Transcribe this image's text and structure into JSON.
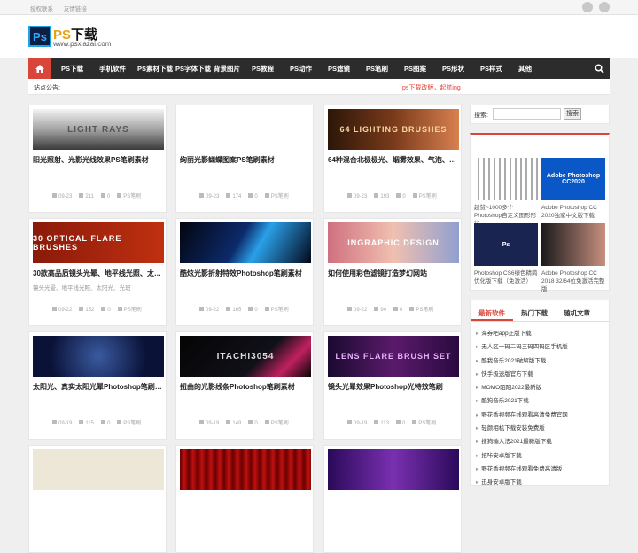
{
  "topbar": {
    "links": [
      "授权联系",
      "友情链接"
    ]
  },
  "header": {
    "logo_mark": "Ps",
    "title_prefix": "PS",
    "title_main": "下载",
    "url": "www.psxiazai.com"
  },
  "nav": {
    "items": [
      "PS下载",
      "手机软件",
      "PS素材下载",
      "PS字体下载",
      "背景图片",
      "PS教程",
      "PS动作",
      "PS滤镜",
      "PS笔刷",
      "PS图案",
      "PS形状",
      "PS样式",
      "其他"
    ]
  },
  "notice": {
    "label": "站点公告:",
    "text": "ps下载改版，起航ing"
  },
  "cards": [
    {
      "title": "阳光照射、光影光线效果PS笔刷素材",
      "date": "09-23",
      "views": "211",
      "comments": "0",
      "cat": "PS笔刷",
      "thumb_text": "LIGHT RAYS",
      "thumb_bg": "linear-gradient(180deg,#f4f4f4 0%,#9a9a9a 55%,#3a3a3a 100%)",
      "thumb_color": "#555"
    },
    {
      "title": "绚丽光影蝴蝶图案PS笔刷素材",
      "date": "09-23",
      "views": "174",
      "comments": "0",
      "cat": "PS笔刷",
      "thumb_text": "",
      "thumb_bg": "#ffffff",
      "thumb_color": "#2a3a7a"
    },
    {
      "title": "64种混合北极极光、烟雾效果、气泡、…",
      "date": "09-23",
      "views": "193",
      "comments": "0",
      "cat": "PS笔刷",
      "thumb_text": "64 LIGHTING BRUSHES",
      "thumb_bg": "linear-gradient(90deg,#2c1608,#7a3a1a,#d88050)",
      "thumb_color": "#f3d9a0"
    },
    {
      "title": "30款高品质镜头光晕、地平线光照、太…",
      "desc": "镜头光晕、地平线光照、太阳光、光斑",
      "date": "09-22",
      "views": "152",
      "comments": "0",
      "cat": "PS笔刷",
      "thumb_text": "30 OPTICAL FLARE BRUSHES",
      "thumb_bg": "linear-gradient(90deg,#8a1a0a,#c03010)",
      "thumb_color": "#ffffff"
    },
    {
      "title": "酷炫光影折射特效Photoshop笔刷素材",
      "date": "09-22",
      "views": "165",
      "comments": "0",
      "cat": "PS笔刷",
      "thumb_text": "",
      "thumb_bg": "linear-gradient(120deg,#03050f 0%,#0c2a6a 45%,#2aa0e8 60%,#04071a 100%)",
      "thumb_color": "#fff"
    },
    {
      "title": "如何使用彩色滤镜打造梦幻网站",
      "date": "09-22",
      "views": "94",
      "comments": "0",
      "cat": "PS笔刷",
      "thumb_text": "INGRAPHIC DESIGN",
      "thumb_bg": "linear-gradient(90deg,#d07080,#f0c0b0,#90a0d0)",
      "thumb_color": "#ffffff"
    },
    {
      "title": "太阳光、真实太阳光晕Photoshop笔刷…",
      "date": "09-19",
      "views": "115",
      "comments": "0",
      "cat": "PS笔刷",
      "thumb_text": "",
      "thumb_bg": "radial-gradient(circle at 50% 50%,#3a5aa0 0%,#0a1238 70%)",
      "thumb_color": "#fff"
    },
    {
      "title": "扭曲的光影线条Photoshop笔刷素材",
      "date": "09-19",
      "views": "149",
      "comments": "0",
      "cat": "PS笔刷",
      "thumb_text": "ITACHI3054",
      "thumb_bg": "linear-gradient(135deg,#050505,#101018 60%,#c02060 80%,#050505)",
      "thumb_color": "#dddddd"
    },
    {
      "title": "镜头光晕效果Photoshop光特效笔刷",
      "date": "09-19",
      "views": "113",
      "comments": "0",
      "cat": "PS笔刷",
      "thumb_text": "LENS FLARE BRUSH SET",
      "thumb_bg": "linear-gradient(90deg,#1a0a30,#5a1a6a,#2a0a40)",
      "thumb_color": "#e8b0ff"
    },
    {
      "title": "",
      "date": "",
      "views": "",
      "comments": "",
      "cat": "",
      "thumb_text": "",
      "thumb_bg": "#ede7d8",
      "thumb_color": "#333"
    },
    {
      "title": "",
      "date": "",
      "views": "",
      "comments": "",
      "cat": "",
      "thumb_text": "",
      "thumb_bg": "repeating-linear-gradient(90deg,#6a0000 0px,#c01010 5px,#6a0000 10px)",
      "thumb_color": "#fff"
    },
    {
      "title": "",
      "date": "",
      "views": "",
      "comments": "",
      "cat": "",
      "thumb_text": "",
      "thumb_bg": "linear-gradient(90deg,#2a0a5a,#7a30b0,#2a0a5a)",
      "thumb_color": "#fff"
    }
  ],
  "sidebar": {
    "search_label": "搜索:",
    "search_button": "搜索",
    "featured": [
      {
        "caption": "超赞~1000多个Photoshop自定义图形形状",
        "bg": "repeating-linear-gradient(90deg,#fff 0px,#fff 4px,#555 5px,#fff 6px)",
        "thumb_text": ""
      },
      {
        "caption": "Adobe Photoshop CC 2020独家中文版下载",
        "bg": "#0a58c8",
        "thumb_text": "Adobe Photoshop CC2020"
      },
      {
        "caption": "Photoshop CS6绿色精简优化版下载（免激活）",
        "bg": "#1a2450",
        "thumb_text": "Ps"
      },
      {
        "caption": "Adobe Photoshop CC 2018 32/64位免激活完整版",
        "bg": "linear-gradient(90deg,#1a1a1a,#c89080)",
        "thumb_text": ""
      }
    ],
    "tabs": [
      "最新软件",
      "热门下载",
      "随机文章"
    ],
    "list": [
      "海券吧app正版下载",
      "无人区一码二码三码四码区手机版",
      "酷我音乐2021破解版下载",
      "快手极速版官方下载",
      "MOMO陌陌2022最新版",
      "酷狗音乐2021下载",
      "野花香视频在线观看高清免费官网",
      "轻颜相机下载安装免费版",
      "搜狗输入法2021最新版下载",
      "拓咔安卓版下载",
      "野花香视频在线观看免费高清版",
      "迅身安卓版下载"
    ]
  },
  "colors": {
    "accent": "#d9453b",
    "nav_bg": "#2c2c2c",
    "brand_blue": "#31a8ff"
  }
}
